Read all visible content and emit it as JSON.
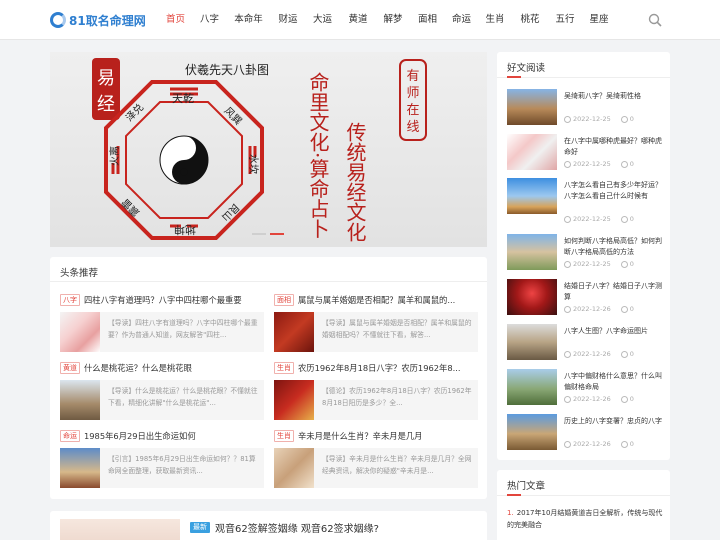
{
  "header": {
    "logo_text": "81取名命理网",
    "nav": [
      "首页",
      "八字",
      "本命年",
      "财运",
      "大运",
      "黄道",
      "解梦",
      "面相",
      "命运",
      "生肖",
      "桃花",
      "五行",
      "星座"
    ],
    "active_index": 0
  },
  "banner": {
    "title": "伏羲先天八卦图",
    "left_seal": "易经",
    "right_seal": "有师在线",
    "vertical_text_1": "命里文化·算命占卜",
    "vertical_text_2": "传统易经文化",
    "trigram_labels": [
      "天乾",
      "风巽",
      "水坎",
      "艮山",
      "地坤",
      "震雷",
      "火离",
      "泽兑"
    ]
  },
  "headlines": {
    "title": "头条推荐",
    "items": [
      {
        "tag": "八字",
        "title": "四柱八字有道理吗？八字中四柱哪个最重要",
        "summary": "【导读】四柱八字有道理吗？八字中四柱哪个最重要？作为普通人知道，网友解答\"四柱..."
      },
      {
        "tag": "面相",
        "title": "属鼠与属羊婚姻是否相配？属羊和属鼠的...",
        "summary": "【导读】属鼠与属羊婚姻是否相配？属羊和属鼠的婚姻相配吗？不懂就往下看，解答..."
      },
      {
        "tag": "黄道",
        "title": "什么是桃花运？什么是桃花眼",
        "summary": "【导读】什么是桃花运？什么是桃花眼？不懂就往下看，精细化讲解\"什么是桃花运\"..."
      },
      {
        "tag": "生肖",
        "title": "农历1962年8月18日八字？农历1962年8...",
        "summary": "【德论】农历1962年8月18日八字？农历1962年8月18日阳历是多少？全..."
      },
      {
        "tag": "命运",
        "title": "1985年6月29日出生命运如何",
        "summary": "【引言】1985年6月29日出生命运如何？？81算命网全面整理，获取最新资讯..."
      },
      {
        "tag": "生肖",
        "title": "辛未月是什么生肖？辛未月是几月",
        "summary": "【导读】辛未月是什么生肖？辛未月是几月？全网经典资讯，解决你的疑惑\"辛未月是..."
      }
    ]
  },
  "bottom_article": {
    "tag": "最新",
    "title": "观音62签解签姻缘 观音62签求姻缘?"
  },
  "sidebar": {
    "good_reads_title": "好文阅读",
    "items": [
      {
        "title": "吴绮莉八字？吴绮莉性格",
        "date": "2022-12-25",
        "comments": "0"
      },
      {
        "title": "在八字中属哪种虎最好？哪种虎命好",
        "date": "2022-12-25",
        "comments": "0"
      },
      {
        "title": "八字怎么看自己有多少年好运？八字怎么看自己什么时候有",
        "date": "2022-12-25",
        "comments": "0"
      },
      {
        "title": "如何判断八字格局高低？如何判断八字格局高低的方法",
        "date": "2022-12-25",
        "comments": "0"
      },
      {
        "title": "结婚日子八字？结婚日子八字测算",
        "date": "2022-12-26",
        "comments": "0"
      },
      {
        "title": "八字人生图？八字命运图片",
        "date": "2022-12-26",
        "comments": "0"
      },
      {
        "title": "八字中偏财格什么意思？什么叫偏财格命局",
        "date": "2022-12-26",
        "comments": "0"
      },
      {
        "title": "历史上的八字变署？忠贞的八字",
        "date": "2022-12-26",
        "comments": "0"
      }
    ],
    "hot_title": "热门文章",
    "hot_items": [
      {
        "num": "1.",
        "title": "2017年10月结婚黄道吉日全解析，传统与现代的完美融合"
      }
    ]
  }
}
